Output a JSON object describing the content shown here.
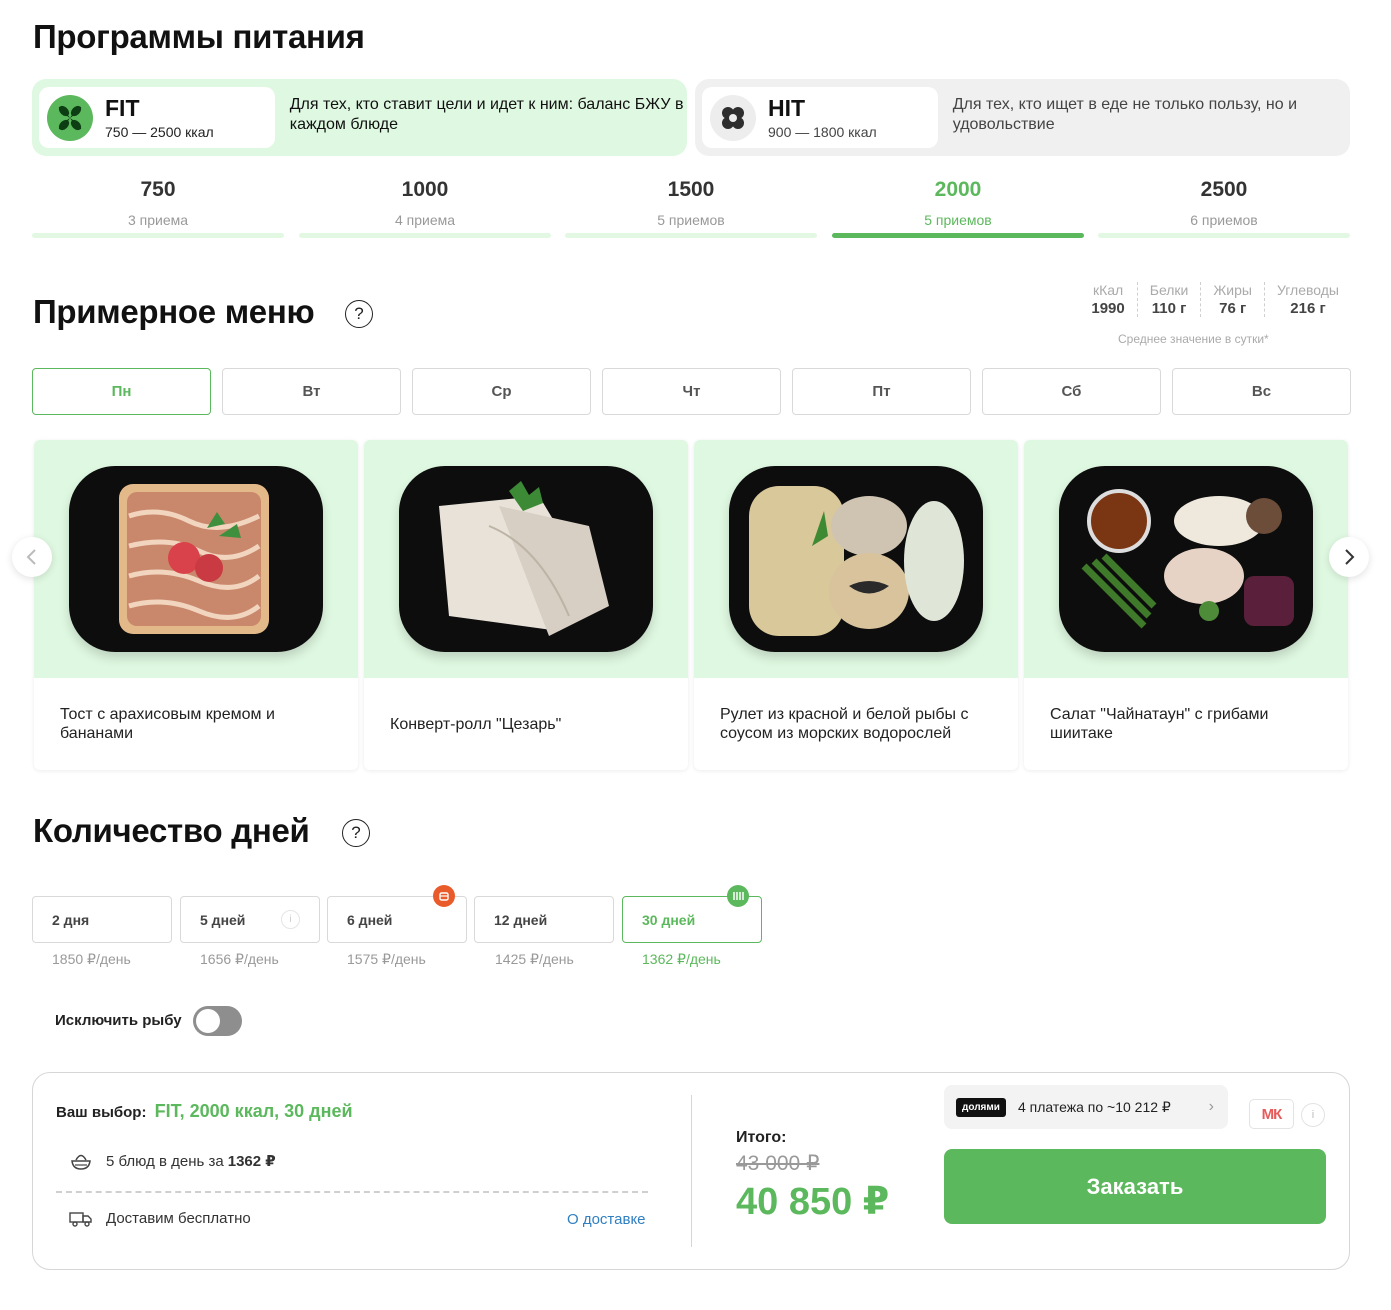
{
  "page_title": "Программы питания",
  "programs": [
    {
      "name": "FIT",
      "range": "750 — 2500 ккал",
      "desc": "Для тех, кто ставит цели и идет к ним: баланс БЖУ в каждом блюде"
    },
    {
      "name": "HIT",
      "range": "900 — 1800 ккал",
      "desc": "Для тех, кто ищет в еде не только пользу, но и удовольствие"
    }
  ],
  "calories": [
    {
      "value": "750",
      "meals": "3 приема"
    },
    {
      "value": "1000",
      "meals": "4 приема"
    },
    {
      "value": "1500",
      "meals": "5 приемов"
    },
    {
      "value": "2000",
      "meals": "5 приемов"
    },
    {
      "value": "2500",
      "meals": "6 приемов"
    }
  ],
  "menu": {
    "title": "Примерное меню",
    "help": "?",
    "macros": [
      {
        "label": "кКал",
        "value": "1990"
      },
      {
        "label": "Белки",
        "value": "110 г"
      },
      {
        "label": "Жиры",
        "value": "76 г"
      },
      {
        "label": "Углеводы",
        "value": "216 г"
      }
    ],
    "avg_note": "Среднее значение в сутки*",
    "days": [
      "Пн",
      "Вт",
      "Ср",
      "Чт",
      "Пт",
      "Сб",
      "Вс"
    ],
    "dishes": [
      "Тост с арахисовым кремом и бананами",
      "Конверт-ролл \"Цезарь\"",
      "Рулет из красной и белой рыбы с соусом из морских водорослей",
      "Салат \"Чайнатаун\" с грибами шиитаке"
    ]
  },
  "days_count": {
    "title": "Количество дней",
    "help": "?",
    "options": [
      {
        "label": "2 дня",
        "price": "1850 ₽/день"
      },
      {
        "label": "5 дней",
        "price": "1656 ₽/день"
      },
      {
        "label": "6 дней",
        "price": "1575 ₽/день"
      },
      {
        "label": "12 дней",
        "price": "1425 ₽/день"
      },
      {
        "label": "30 дней",
        "price": "1362 ₽/день"
      }
    ]
  },
  "exclude_fish": "Исключить рыбу",
  "summary": {
    "choice_label": "Ваш выбор:",
    "choice_value": "FIT, 2000 ккал, 30 дней",
    "meals_text": "5 блюд в день за",
    "meals_price": "1362 ₽",
    "delivery_text": "Доставим бесплатно",
    "delivery_link": "О доставке",
    "total_label": "Итого:",
    "old_price": "43 000 ₽",
    "new_price": "40 850 ₽",
    "dolyami_logo": "долями",
    "dolyami_text": "4 платежа по ~10 212 ₽",
    "mk_logo": "МК",
    "order_button": "Заказать"
  },
  "colors": {
    "accent": "#5cb85c",
    "light_green": "#dff8e1",
    "link": "#2f7fc1"
  }
}
